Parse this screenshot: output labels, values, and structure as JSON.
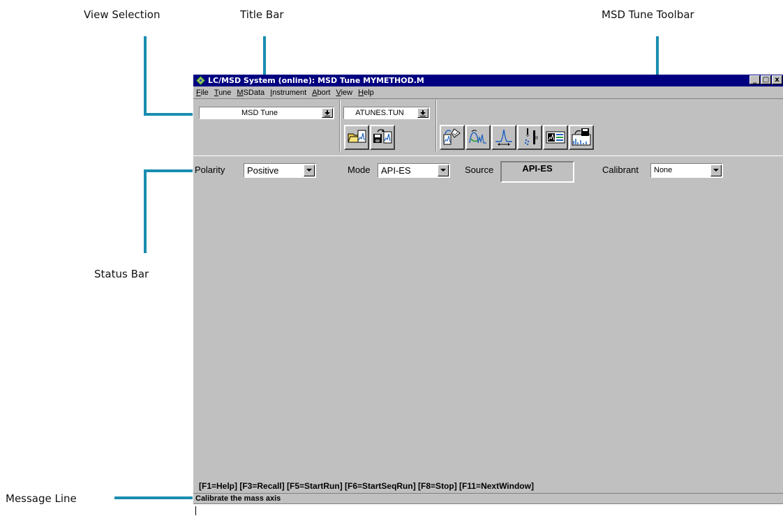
{
  "callouts": {
    "view_selection": "View Selection",
    "title_bar": "Title Bar",
    "msd_tune_toolbar": "MSD Tune Toolbar",
    "status_bar": "Status Bar",
    "message_line": "Message Line"
  },
  "window": {
    "title": "LC/MSD System (online): MSD Tune MYMETHOD.M",
    "controls": {
      "minimize": "_",
      "maximize": "□",
      "close": "x"
    }
  },
  "menu": [
    "File",
    "Tune",
    "MSData",
    "Instrument",
    "Abort",
    "View",
    "Help"
  ],
  "toolbar": {
    "view_select": "MSD Tune",
    "tune_file": "ATUNES.TUN",
    "icons": [
      "load-tune-icon",
      "save-tune-icon",
      "autotune-icon",
      "profile-icon",
      "peak-width-icon",
      "spray-chamber-icon",
      "tune-report-icon",
      "save-profile-icon"
    ]
  },
  "status": {
    "polarity_label": "Polarity",
    "polarity_value": "Positive",
    "mode_label": "Mode",
    "mode_value": "API-ES",
    "source_label": "Source",
    "source_value": "API-ES",
    "calibrant_label": "Calibrant",
    "calibrant_value": "None"
  },
  "function_keys": "[F1=Help]  [F3=Recall]  [F5=StartRun]  [F6=StartSeqRun]  [F8=Stop]  [F11=NextWindow]",
  "message_line": "Calibrate the mass axis",
  "colors": {
    "titlebar": "#000080",
    "callout": "#1a8db0",
    "face": "#c0c0c0"
  }
}
